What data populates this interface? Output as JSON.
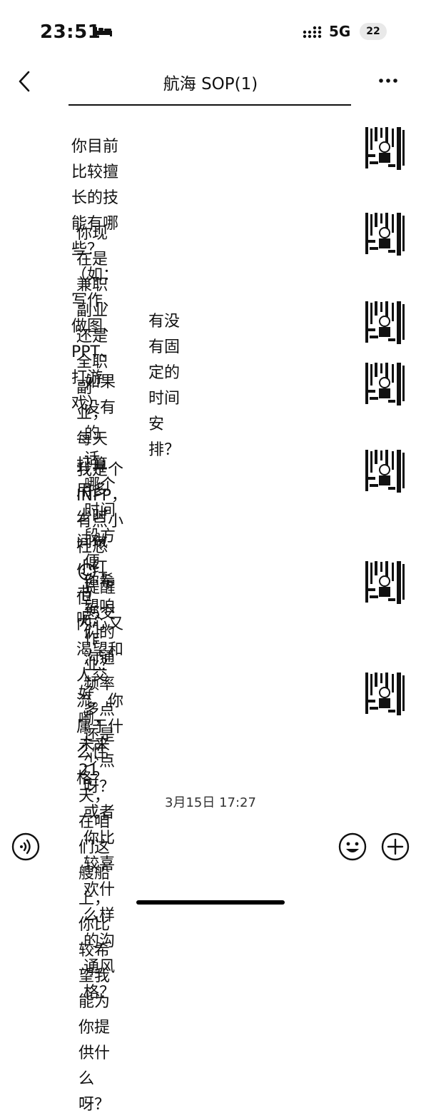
{
  "status_bar": {
    "time": "23:51",
    "network": "5G",
    "battery": "22"
  },
  "header": {
    "title": "航海 SOP(1)"
  },
  "messages": [
    {
      "text": "你目前比较擅长的技能有哪些？\n（如：写作、做图、PPT、打游戏）"
    },
    {
      "text": "你现在是兼职副业还是全职副业，\n每天打算用多少时间做小红书呢？"
    },
    {
      "text": "有没有固定的时间安排？"
    },
    {
      "text": "如果没有的话，哪个时间段方便\n提醒您交作业？"
    },
    {
      "text": "我是个 INFP，有点小社恐",
      "text_after": "，但\n内心又渴望和人交流。你属于什\n么性格？"
    },
    {
      "text": "你希望咱们的沟通频率多点还是\n少点呀？或者你比较喜欢什么样\n的沟通风格？"
    },
    {
      "text": "好嘞，未来 21天，在咱们这艘船\n上，你比较希望我能为你提供什\n么呀？"
    }
  ],
  "timestamp": "3月15日 17:27",
  "icons": {
    "back": "chevron-left-icon",
    "more": "more-dots-icon",
    "voice": "voice-icon",
    "emoji": "emoji-icon",
    "add": "plus-icon"
  }
}
